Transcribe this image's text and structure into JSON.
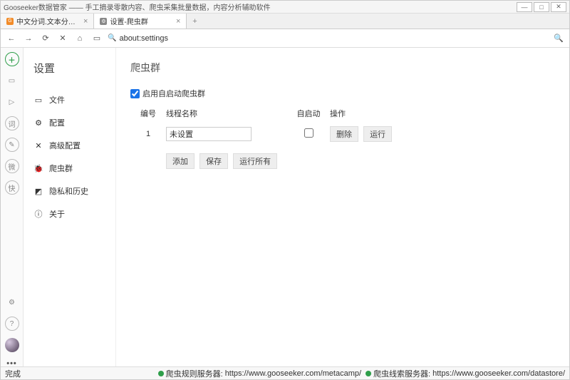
{
  "window": {
    "title": "Gooseeker数据管家 —— 手工摘录零散内容、爬虫采集批量数据，内容分析辅助软件",
    "min": "—",
    "max": "□",
    "close": "✕"
  },
  "tabs": {
    "t1": {
      "fav": "G",
      "label": "中文分词.文本分析.情感分析.关键词"
    },
    "t2": {
      "fav": "⚙",
      "label": "设置-爬虫群"
    },
    "plus": "+"
  },
  "toolbar": {
    "back": "←",
    "fwd": "→",
    "reload": "⟳",
    "stop": "✕",
    "home": "⌂",
    "addr_icon": "🔍",
    "url": "about:settings",
    "search": "🔍"
  },
  "leftbar": {
    "plus": "＋",
    "doc": "▭",
    "flag": "▷",
    "word": "词",
    "pen": "✎",
    "wei": "微",
    "quick": "快",
    "gear": "⚙",
    "help": "?",
    "dots": "•••"
  },
  "nav": {
    "title": "设置",
    "file": {
      "icon": "▭",
      "label": "文件"
    },
    "config": {
      "icon": "⚙",
      "label": "配置"
    },
    "adv": {
      "icon": "✕",
      "label": "高级配置"
    },
    "swarm": {
      "icon": "🐞",
      "label": "爬虫群"
    },
    "privacy": {
      "icon": "◩",
      "label": "隐私和历史"
    },
    "about": {
      "icon": "ⓘ",
      "label": "关于"
    }
  },
  "page": {
    "heading": "爬虫群",
    "enable_label": "启用自启动爬虫群",
    "col_id": "编号",
    "col_name": "线程名称",
    "col_auto": "自启动",
    "col_ops": "操作",
    "row1": {
      "id": "1",
      "name": "未设置"
    },
    "btn_del": "删除",
    "btn_run": "运行",
    "btn_add": "添加",
    "btn_save": "保存",
    "btn_runall": "运行所有"
  },
  "status": {
    "done": "完成",
    "s1_label": "爬虫规则服务器:",
    "s1_url": "https://www.gooseeker.com/metacamp/",
    "s2_label": "爬虫线索服务器:",
    "s2_url": "https://www.gooseeker.com/datastore/"
  }
}
